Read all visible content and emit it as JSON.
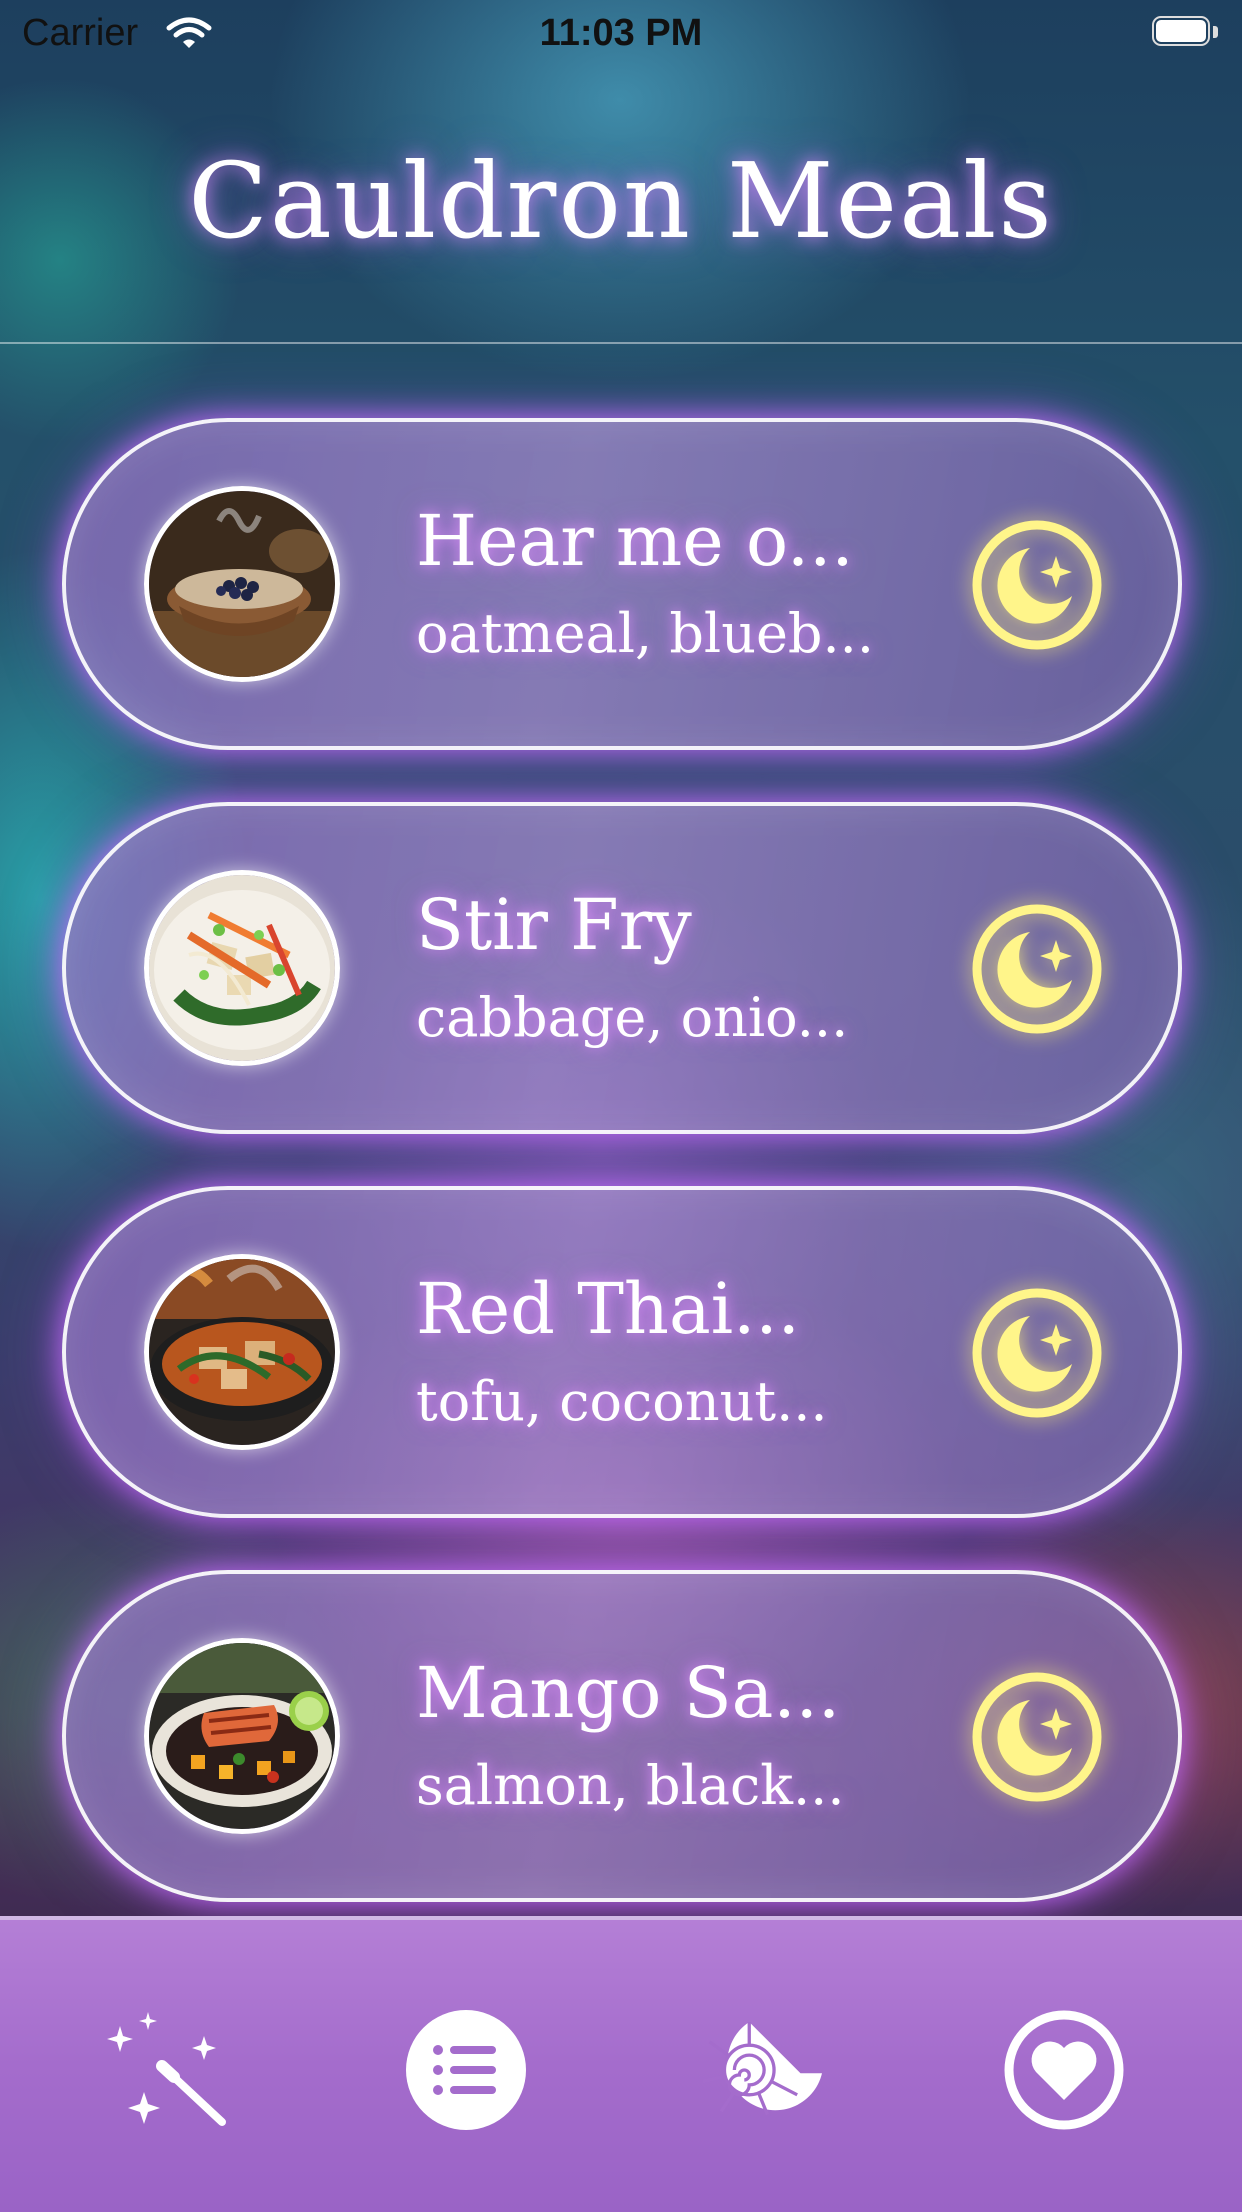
{
  "status_bar": {
    "carrier": "Carrier",
    "time": "11:03 PM"
  },
  "app": {
    "title": "Cauldron Meals"
  },
  "meals": [
    {
      "name": "Hear me o...",
      "ingredients": "oatmeal, blueb...",
      "image": "oatmeal-bowl-photo",
      "action_icon": "moon-star-icon"
    },
    {
      "name": "Stir Fry",
      "ingredients": "cabbage, onio...",
      "image": "stir-fry-plate-photo",
      "action_icon": "moon-star-icon"
    },
    {
      "name": "Red Thai...",
      "ingredients": "tofu, coconut...",
      "image": "red-thai-curry-pan-photo",
      "action_icon": "moon-star-icon"
    },
    {
      "name": "Mango Sa...",
      "ingredients": "salmon, black...",
      "image": "mango-salmon-plate-photo",
      "action_icon": "moon-star-icon"
    }
  ],
  "tab_bar": {
    "tabs": [
      {
        "icon": "magic-wand-icon"
      },
      {
        "icon": "list-icon",
        "selected": true
      },
      {
        "icon": "nautilus-shell-icon"
      },
      {
        "icon": "heart-icon"
      }
    ]
  },
  "colors": {
    "accent_yellow": "#fff58a",
    "card_border": "#ffffff",
    "tab_bar": "#a46ccc",
    "glow": "#c77dff"
  }
}
